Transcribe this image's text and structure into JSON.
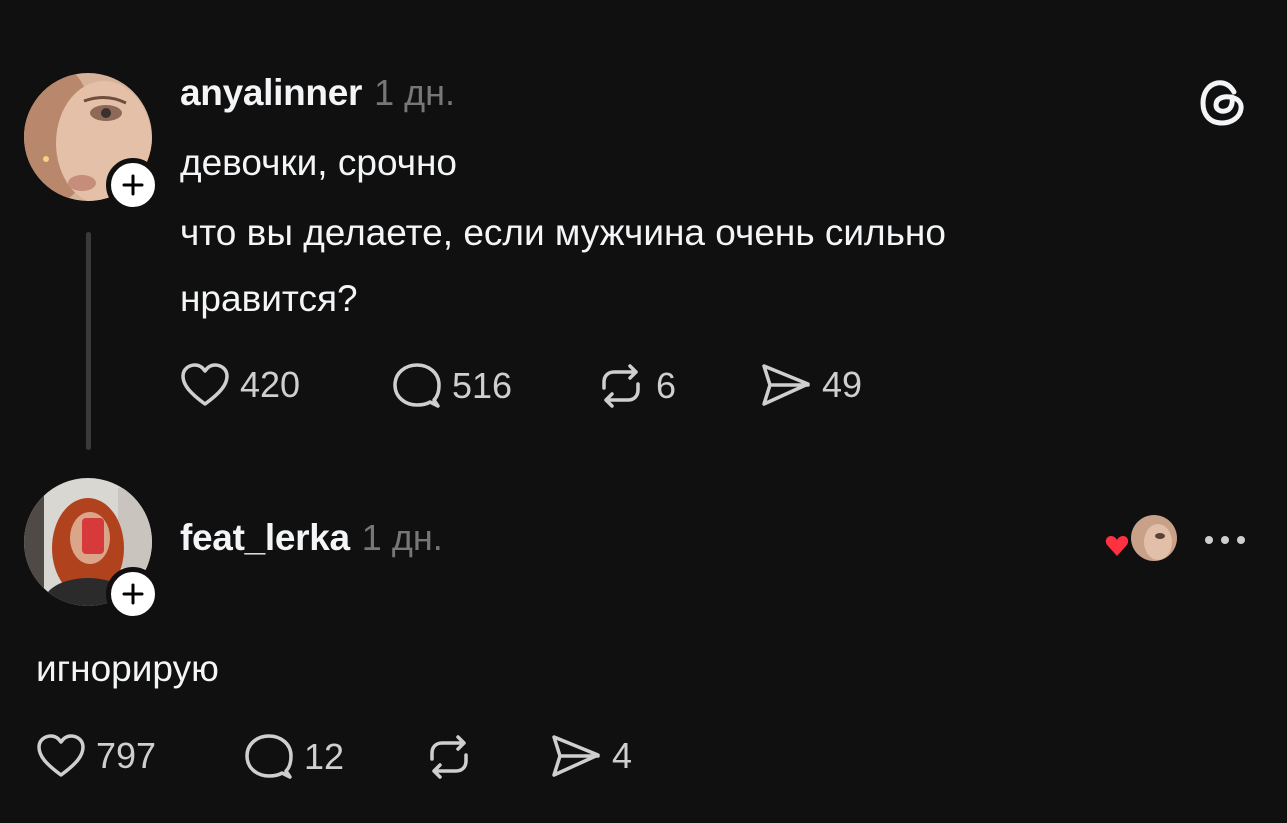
{
  "post": {
    "username": "anyalinner",
    "time": "1 дн.",
    "lines": [
      "девочки, срочно",
      "что вы делаете, если мужчина очень сильно",
      "нравится?"
    ],
    "likes": "420",
    "replies": "516",
    "reposts": "6",
    "shares": "49"
  },
  "reply": {
    "username": "feat_lerka",
    "time": "1 дн.",
    "text": "игнорирую",
    "likes": "797",
    "replies": "12",
    "shares": "4"
  },
  "icons": {
    "logo": "threads-logo-icon",
    "like": "heart-icon",
    "reply": "speech-bubble-icon",
    "repost": "repost-icon",
    "share": "send-icon",
    "more": "more-dots-icon",
    "liked_by": "author-liked-heart-icon"
  },
  "colors": {
    "background": "#101010",
    "text": "#f3f5f7",
    "secondary": "#777777",
    "heart_red": "#ff3040"
  }
}
